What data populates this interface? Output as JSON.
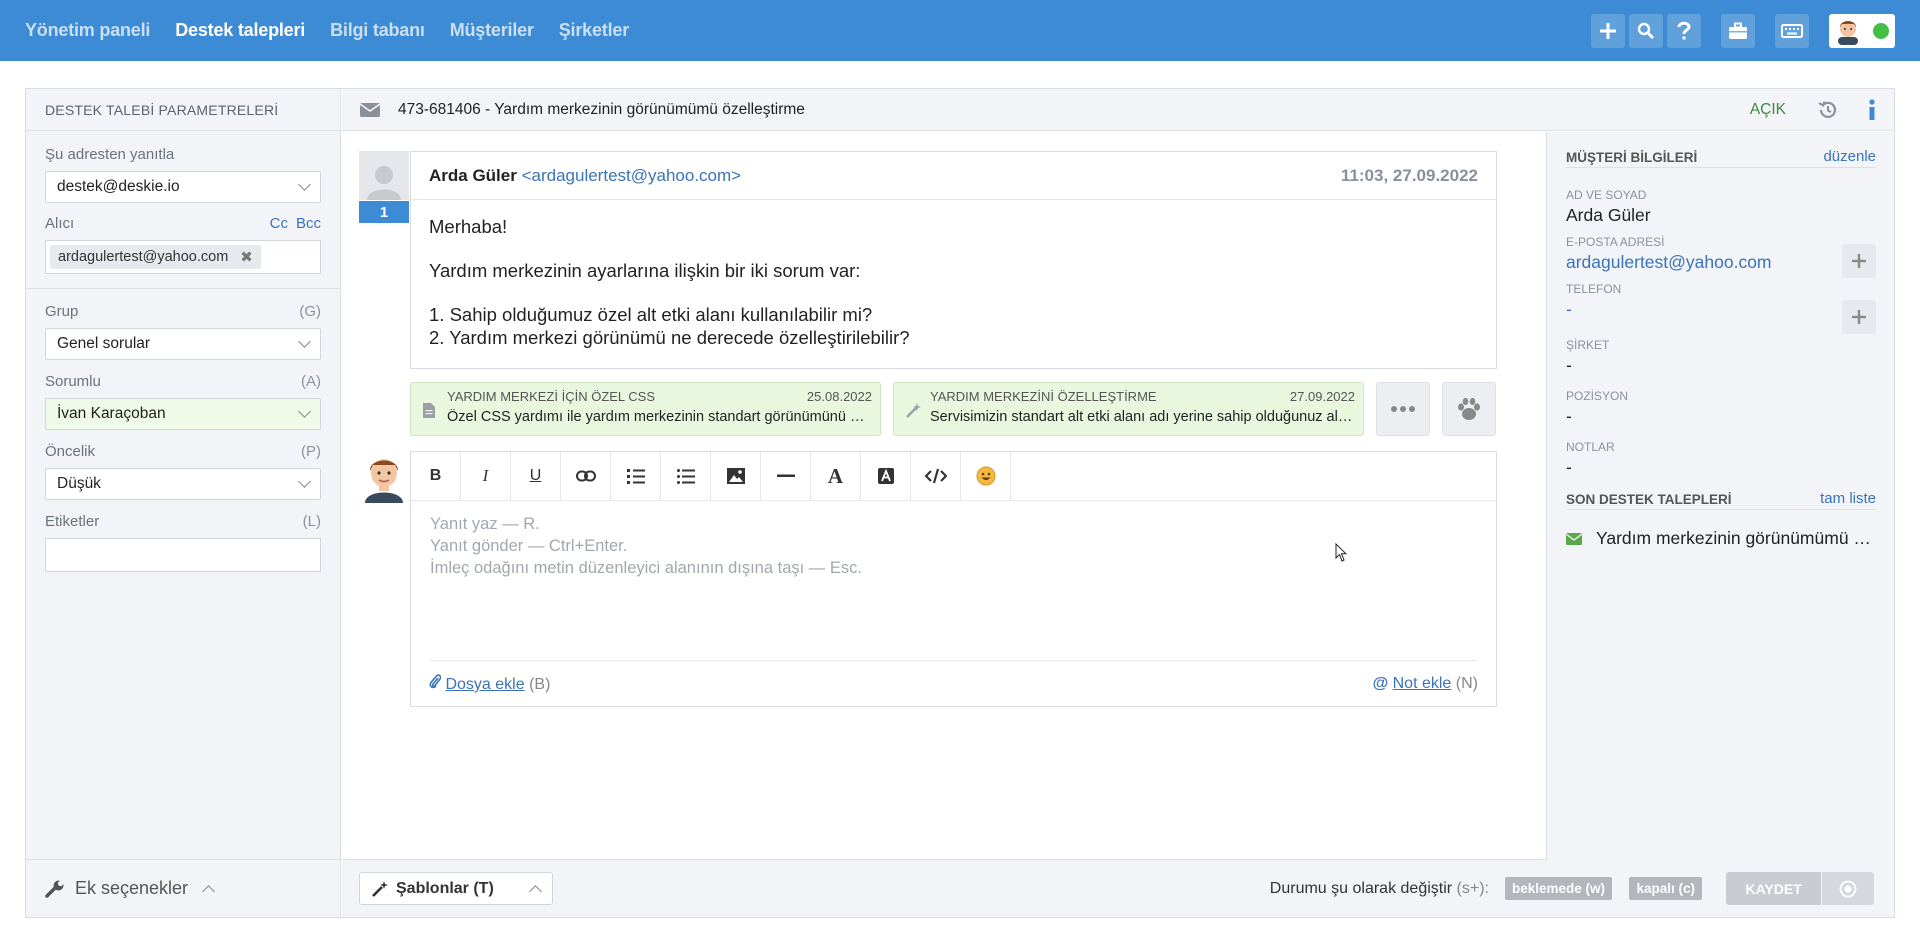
{
  "nav": {
    "items": [
      "Yönetim paneli",
      "Destek talepleri",
      "Bilgi tabanı",
      "Müşteriler",
      "Şirketler"
    ],
    "active_index": 1
  },
  "left": {
    "header": "DESTEK TALEBİ PARAMETRELERİ",
    "reply_from_label": "Şu adresten yanıtla",
    "reply_from_value": "destek@deskie.io",
    "recipient_label": "Alıcı",
    "cc": "Cc",
    "bcc": "Bcc",
    "recipient_tag": "ardagulertest@yahoo.com",
    "group_label": "Grup",
    "group_key": "(G)",
    "group_value": "Genel sorular",
    "owner_label": "Sorumlu",
    "owner_key": "(A)",
    "owner_value": "İvan Karaçoban",
    "priority_label": "Öncelik",
    "priority_key": "(P)",
    "priority_value": "Düşük",
    "tags_label": "Etiketler",
    "tags_key": "(L)",
    "more_options": "Ek seçenekler"
  },
  "ticket": {
    "title": "473-681406 - Yardım merkezinin görünümümü özelleştirme",
    "status": "AÇIK"
  },
  "message": {
    "number": "1",
    "sender_name": "Arda Güler",
    "sender_email": "<ardagulertest@yahoo.com>",
    "time": "11:03, 27.09.2022",
    "line1": "Merhaba!",
    "line2": "Yardım merkezinin ayarlarına ilişkin bir iki sorum var:",
    "line3": "1. Sahip olduğumuz özel alt etki alanı kullanılabilir mi?",
    "line4": "2. Yardım merkezi görünümü ne derecede özelleştirilebilir?"
  },
  "kb": [
    {
      "title": "YARDIM MERKEZİ İÇİN ÖZEL CSS",
      "date": "25.08.2022",
      "text": "Özel CSS yardımı ile yardım merkezinin standart görünümünü değiştirebilirsiniz"
    },
    {
      "title": "YARDIM MERKEZİNİ ÖZELLEŞTİRME",
      "date": "27.09.2022",
      "text": "Servisimizin standart alt etki alanı adı yerine sahip olduğunuz alan adını kullanabilirsiniz"
    }
  ],
  "editor": {
    "hint1": "Yanıt yaz — R.",
    "hint2": "Yanıt gönder — Ctrl+Enter.",
    "hint3": "İmleç odağını metin düzenleyici alanının dışına taşı — Esc.",
    "attach_label": "Dosya ekle",
    "attach_key": "(B)",
    "note_label": "Not ekle",
    "note_key": "(N)"
  },
  "footer": {
    "templates": "Şablonlar (T)",
    "status_change": "Durumu şu olarak değiştir",
    "status_key": "(s+):",
    "pending": "beklemede (w)",
    "closed": "kapalı (c)",
    "save": "KAYDET"
  },
  "customer": {
    "header": "MÜŞTERİ BİLGİLERİ",
    "edit": "düzenle",
    "name_label": "AD VE SOYAD",
    "name": "Arda Güler",
    "email_label": "E-POSTA ADRESİ",
    "email": "ardagulertest@yahoo.com",
    "phone_label": "TELEFON",
    "phone": "-",
    "company_label": "ŞİRKET",
    "company": "-",
    "position_label": "POZİSYON",
    "position": "-",
    "notes_label": "NOTLAR",
    "notes": "-",
    "recent_header": "SON DESTEK TALEPLERİ",
    "full_list": "tam liste",
    "recent_item": "Yardım merkezinin görünümümü özelleştirme"
  },
  "colors": {
    "topbar": "#3d8bd4",
    "link": "#3b73b9",
    "open": "#3e8a3e",
    "kb_bg": "#e9f7df"
  }
}
